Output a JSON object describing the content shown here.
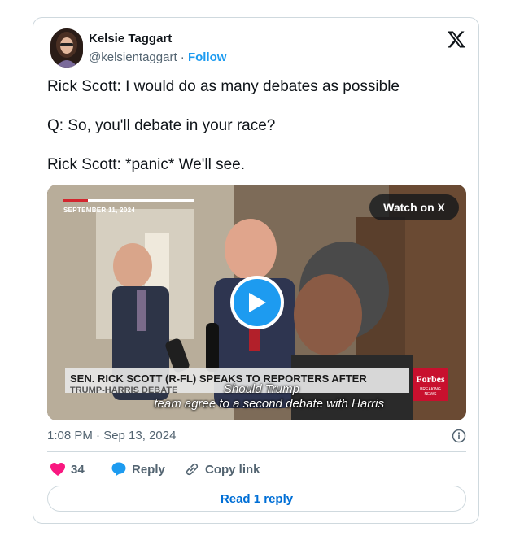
{
  "author": {
    "name": "Kelsie Taggart",
    "handle": "@kelsientaggart",
    "separator": "·",
    "follow_label": "Follow"
  },
  "tweet": {
    "lines": [
      "Rick Scott: I would do as many debates as possible",
      "Q: So, you'll debate in your race?",
      "Rick Scott: *panic* We'll see."
    ]
  },
  "media": {
    "date_stamp": "SEPTEMBER 11, 2024",
    "watch_label": "Watch on X",
    "lower_third": "SEN. RICK SCOTT (R-FL) SPEAKS TO REPORTERS AFTER",
    "lower_third_sub": "TRUMP-HARRIS DEBATE",
    "brand": "Forbes",
    "brand_tag": "BREAKING NEWS",
    "caption_line1": "Should Trump",
    "caption_line2": "team agree to a second debate with Harris"
  },
  "meta": {
    "timestamp": "1:08 PM · Sep 13, 2024"
  },
  "actions": {
    "like_count": "34",
    "reply_label": "Reply",
    "copy_label": "Copy link"
  },
  "read_reply_label": "Read 1 reply",
  "colors": {
    "accent": "#1d9bf0",
    "like": "#f91880",
    "link": "#006fd6",
    "border": "#cfd9de",
    "muted": "#536471"
  },
  "icons": [
    "x-logo-icon",
    "play-icon",
    "heart-icon",
    "reply-bubble-icon",
    "link-icon",
    "info-icon"
  ]
}
